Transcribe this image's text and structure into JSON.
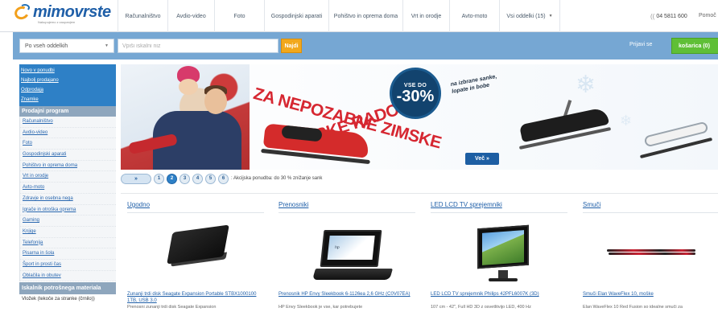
{
  "header": {
    "logo_name": "mimovrste",
    "logo_tagline": "Nakupujemo z zaupanjem",
    "nav": [
      {
        "label": "Računalništvo",
        "w": 62
      },
      {
        "label": "Avdio-video",
        "w": 58
      },
      {
        "label": "Foto",
        "w": 62
      },
      {
        "label": "Gospodinjski aparati",
        "w": 80
      },
      {
        "label": "Pohištvo in oprema doma",
        "w": 92
      },
      {
        "label": "Vrt in orodje",
        "w": 58
      },
      {
        "label": "Avto-moto",
        "w": 62
      },
      {
        "label": "Vsi oddelki (15)",
        "w": 76,
        "dropdown": true
      }
    ],
    "phone": "04 5811 600",
    "help": "Pomoč"
  },
  "search": {
    "category": "Po vseh oddelkih",
    "placeholder": "Vpiši iskalni niz",
    "button": "Najdi",
    "login": "Prijavi se",
    "cart": "košarica (0)"
  },
  "sidebar": {
    "promo": [
      "Novo v ponudbi",
      "Najbolj prodajano",
      "Odprodaja",
      "Znamke"
    ],
    "section1": "Prodajni program",
    "items": [
      "Računalništvo",
      "Avdio-video",
      "Foto",
      "Gospodinjski aparati",
      "Pohištvo in oprema doma",
      "Vrt in orodje",
      "Avto-moto",
      "Zdravje in osebna nega",
      "Igrače in otroška oprema",
      "Gaming",
      "Knjige",
      "Telefonija",
      "Pisarna in šola",
      "Šport in prosti čas",
      "Oblačila in obutev"
    ],
    "section2": "Iskalnik potrošnega materiala",
    "section2_sub": "Vložek (tekoče za stranke (črnilo))"
  },
  "banner": {
    "slogan_line1": "ZA NEPOZABNE ZIMSKE",
    "slogan_line2": "SKE RADOSTI!",
    "sale_top": "VSE DO",
    "sale_pct": "-30%",
    "note": "na izbrane sanke, lopate in bobe",
    "more": "Več »"
  },
  "slider": {
    "play": "»",
    "dots": [
      "1",
      "2",
      "3",
      "4",
      "5",
      "6"
    ],
    "active_index": 1,
    "caption": ": Akcijska ponudba: do 30 % znižanje sank"
  },
  "products": [
    {
      "category": "Ugodno",
      "name": "Zunanji trdi disk Seagate Expansion Portable STBX1000100 1TB, USB 3.0",
      "desc": "Prenosni zunanji trdi disk Seagate Expansion"
    },
    {
      "category": "Prenosniki",
      "name": "Prenosnik HP Envy Sleekbook 6-1126ea 2,6 GHz (C0V07EA)",
      "desc": "HP Envy Sleekbook je vse, kar potrebujete"
    },
    {
      "category": "LED LCD TV sprejemniki",
      "name": "LED LCD TV sprejemnik Philips 42PFL6007K (3D)",
      "desc": "107 cm - 42\", Full HD 3D z osvetlitvijo LED, 400 Hz"
    },
    {
      "category": "Smuči",
      "name": "Smuči Elan WaveFlex 10, moške",
      "desc": "Elan WaveFlex 10 Red Fusion so idealne smuči za"
    }
  ],
  "colors": {
    "brand_blue": "#1f5fa8",
    "search_bar": "#76a7d3",
    "search_button": "#f2a81c",
    "cart_green": "#5fbf36",
    "sale_red": "#d62731",
    "sidebar_promo": "#2e80c6"
  }
}
